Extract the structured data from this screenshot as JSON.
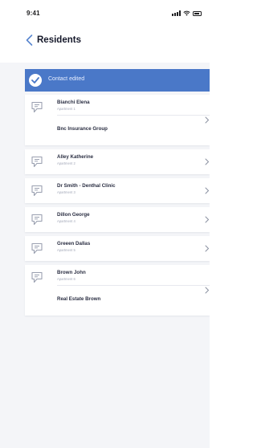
{
  "status_bar": {
    "time": "9:41"
  },
  "nav": {
    "title": "Residents"
  },
  "banner": {
    "message": "Contact edited",
    "color": "#4a78c8"
  },
  "residents": [
    {
      "name": "Bianchi Elena",
      "apartment": "Apartment 1",
      "company": "Bnc Insurance Group"
    },
    {
      "name": "Alley Katherine",
      "apartment": "Apartment 2"
    },
    {
      "name": "Dr Smith - Denthal Clinic",
      "apartment": "Apartment 3"
    },
    {
      "name": "Dillon George",
      "apartment": "Apartment 4"
    },
    {
      "name": "Greeen Dallas",
      "apartment": "Apartment 5"
    },
    {
      "name": "Brown John",
      "apartment": "Apartment 6",
      "company": "Real Estate Brown"
    }
  ]
}
